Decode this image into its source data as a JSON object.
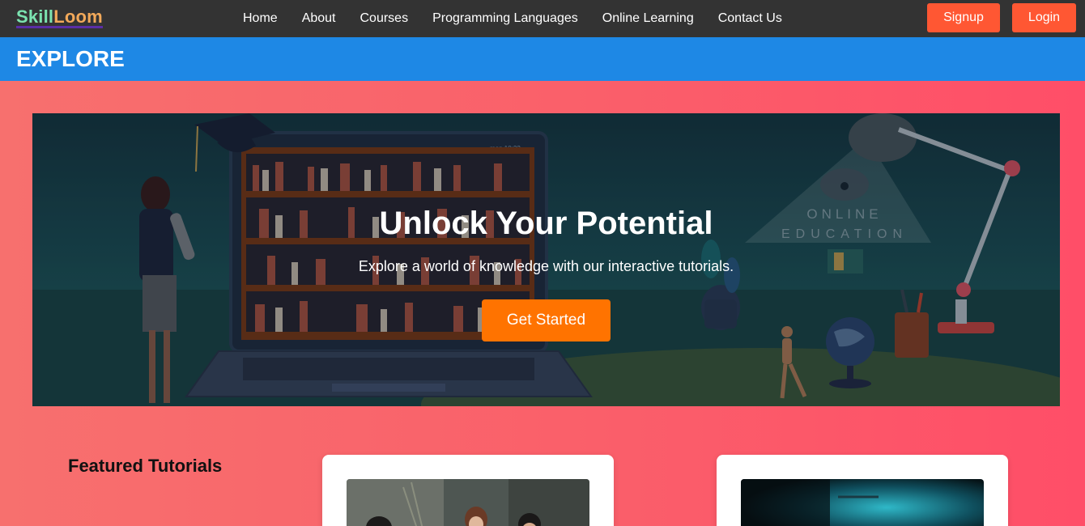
{
  "brand": {
    "part1": "Skill",
    "part2": "Loom"
  },
  "nav": {
    "links": [
      "Home",
      "About",
      "Courses",
      "Programming Languages",
      "Online Learning",
      "Contact Us"
    ],
    "signup_label": "Signup",
    "login_label": "Login"
  },
  "explore": {
    "title": "EXPLORE"
  },
  "hero": {
    "title": "Unlock Your Potential",
    "subtitle": "Explore a world of knowledge with our interactive tutorials.",
    "cta_label": "Get Started",
    "art_text_line1": "ONLINE",
    "art_text_line2": "EDUCATION",
    "art_laptop_status": "mon 10:22"
  },
  "featured": {
    "title": "Featured Tutorials"
  },
  "colors": {
    "navbar": "#333333",
    "accent_orange": "#ff5733",
    "cta_orange": "#ff7300",
    "explore_blue": "#1e88e5",
    "page_gradient": [
      "#f7706e",
      "#ff4e68"
    ]
  }
}
